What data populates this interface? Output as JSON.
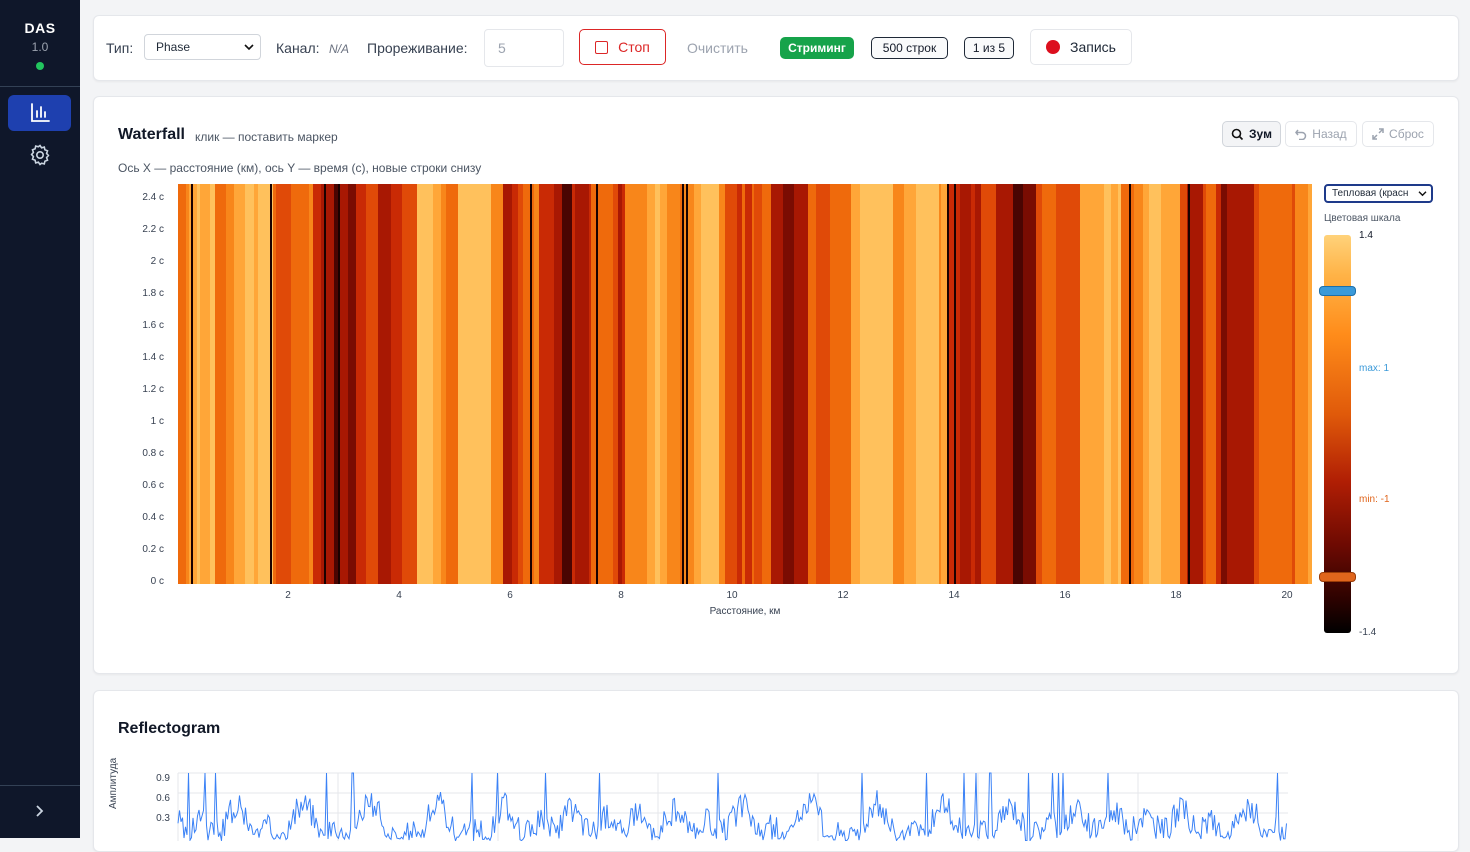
{
  "sidebar": {
    "app_name": "DAS",
    "version": "1.0",
    "status_color": "#22c55e"
  },
  "toolbar": {
    "type_label": "Тип:",
    "type_value": "Phase",
    "channel_label": "Канал:",
    "channel_value": "N/A",
    "decimation_label": "Прореживание:",
    "decimation_value": "5",
    "stop_label": "Стоп",
    "clear_label": "Очистить",
    "streaming_badge": "Стриминг",
    "rows_badge": "500 строк",
    "page_badge": "1 из 5",
    "record_label": "Запись"
  },
  "waterfall": {
    "title": "Waterfall",
    "hint": "клик — поставить маркер",
    "description": "Ось X — расстояние (км), ось Y — время (с), новые строки снизу",
    "zoom_label": "Зум",
    "back_label": "Назад",
    "reset_label": "Сброс",
    "colormap_value": "Тепловая (красн",
    "colorscale_label": "Цветовая шкала",
    "cbar_top": "1.4",
    "cbar_bottom": "-1.4",
    "max_label": "max: 1",
    "min_label": "min: -1",
    "xlabel": "Расстояние, км",
    "ytick_labels": [
      "2.4 с",
      "2.2 с",
      "2 с",
      "1.8 с",
      "1.6 с",
      "1.4 с",
      "1.2 с",
      "1 с",
      "0.8 с",
      "0.6 с",
      "0.4 с",
      "0.2 с",
      "0 с"
    ],
    "xtick_labels": [
      "2",
      "4",
      "6",
      "8",
      "10",
      "12",
      "14",
      "16",
      "18",
      "20"
    ],
    "max_color": "#3b9ad9",
    "min_color": "#e0651c"
  },
  "reflectogram": {
    "title": "Reflectogram",
    "ylabel": "Амплитуда",
    "ytick_labels": [
      "0.9",
      "0.6",
      "0.3"
    ],
    "line_color": "#3b82f6"
  }
}
